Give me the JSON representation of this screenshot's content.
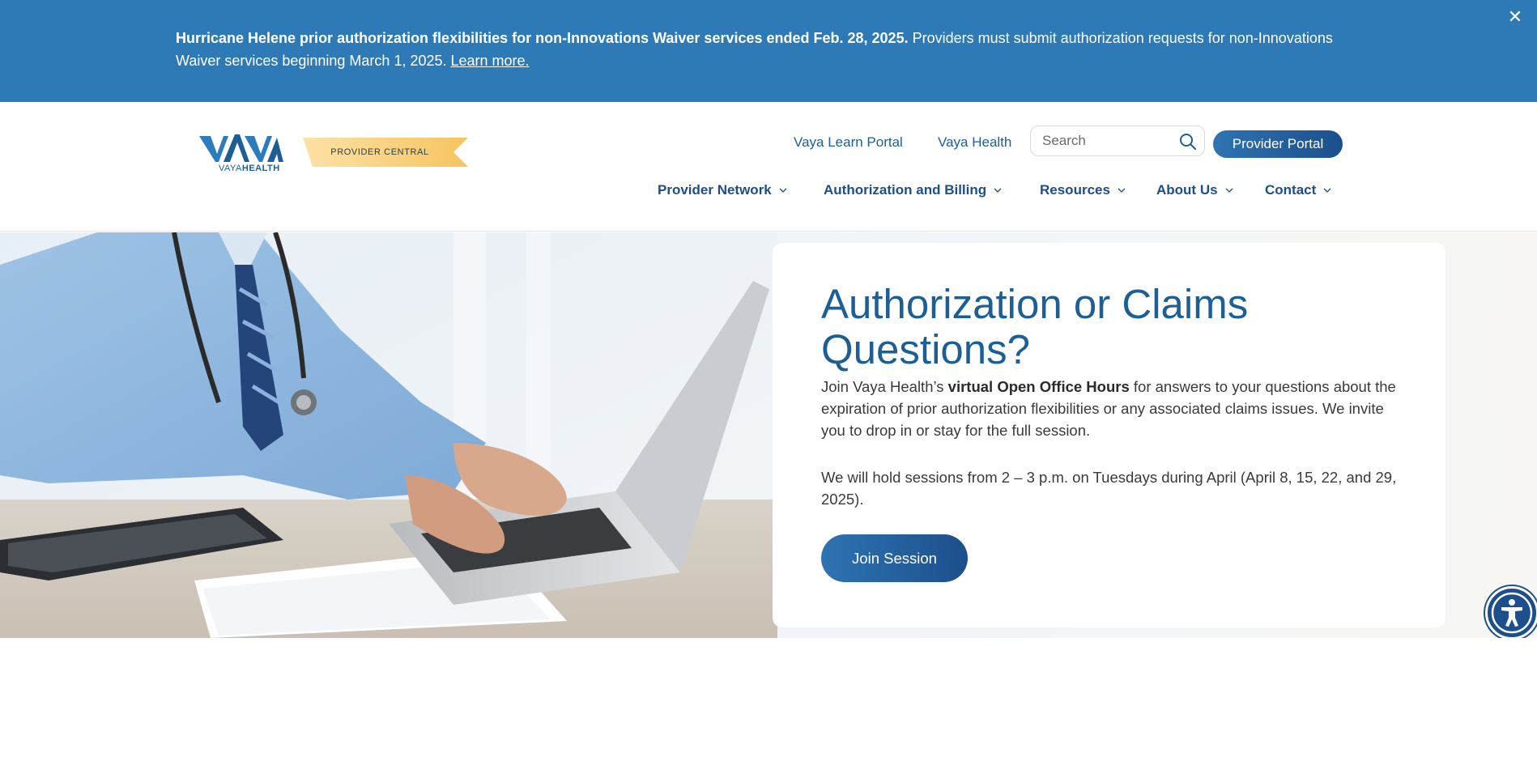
{
  "alert": {
    "headline": "Hurricane Helene prior authorization flexibilities for non-Innovations Waiver services ended Feb. 28, 2025.",
    "body": " Providers must submit authorization requests for non-Innovations Waiver services beginning March 1, 2025. ",
    "link_label": "Learn more.",
    "close_label": "✕"
  },
  "brand": {
    "logo_word_light": "VAYA",
    "logo_word_bold": "HEALTH",
    "ribbon_label": "PROVIDER CENTRAL"
  },
  "utility": {
    "learn_portal": "Vaya Learn Portal",
    "vaya_health": "Vaya Health",
    "search_placeholder": "Search",
    "provider_portal": "Provider Portal"
  },
  "nav": {
    "items": [
      {
        "label": "Provider Network"
      },
      {
        "label": "Authorization and Billing"
      },
      {
        "label": "Resources"
      },
      {
        "label": "About Us"
      },
      {
        "label": "Contact"
      }
    ]
  },
  "hero": {
    "title": "Authorization or Claims Questions?",
    "p1_start": "Join Vaya Health’s ",
    "p1_bold": "virtual Open Office Hours",
    "p1_end": " for answers to your questions about the expiration of prior authorization flexibilities or any associated claims issues. We invite you to drop in or stay for the full session.",
    "p2": "We will hold sessions from 2 – 3 p.m. on Tuesdays during April (April 8, 15, 22, and 29, 2025).",
    "button": "Join Session"
  },
  "colors": {
    "alert_bg": "#2e7ab6",
    "brand_blue": "#1d5f95",
    "nav_blue": "#1d4f86",
    "ribbon_gold": "#f7c96e"
  },
  "icons": {
    "close": "close-icon",
    "search": "search-icon",
    "chevron": "chevron-down-icon",
    "accessibility": "accessibility-icon"
  }
}
